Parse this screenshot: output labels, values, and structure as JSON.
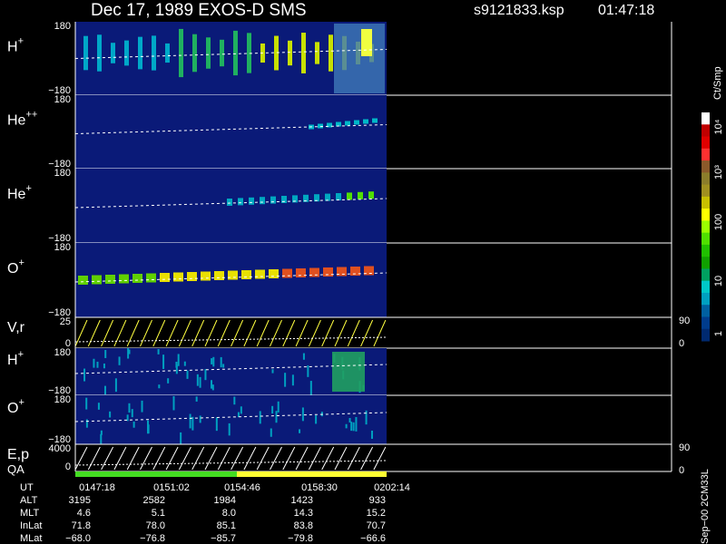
{
  "header": {
    "title": "Dec 17, 1989    EXOS-D SMS",
    "file": "s9121833.ksp",
    "time": "01:47:18"
  },
  "colorbar": {
    "unit": "Ct/Smp",
    "ticks": [
      "10⁴",
      "10³",
      "100",
      "10",
      "1"
    ],
    "colors": [
      "#ffffff",
      "#c00000",
      "#e00000",
      "#ff3030",
      "#8b5a2b",
      "#8b7d2b",
      "#a09020",
      "#c8c000",
      "#ffff00",
      "#9aff00",
      "#50e000",
      "#20c000",
      "#10a000",
      "#00a060",
      "#00c8c8",
      "#00a0c0",
      "#0060a0",
      "#003c8c",
      "#002a70"
    ]
  },
  "chart_data": {
    "type": "heatmap",
    "panels": [
      {
        "id": "h",
        "label": "H",
        "sup": "+",
        "ytop": "180",
        "ybot": "−180"
      },
      {
        "id": "he2",
        "label": "He",
        "sup": "++",
        "ytop": "180",
        "ybot": "−180"
      },
      {
        "id": "he1",
        "label": "He",
        "sup": "+",
        "ytop": "180",
        "ybot": "−180"
      },
      {
        "id": "o",
        "label": "O",
        "sup": "+",
        "ytop": "180",
        "ybot": "−180"
      },
      {
        "id": "vr",
        "label": "V,r",
        "sup": "",
        "ytop": "25",
        "ybot": "0",
        "rtop": "90",
        "rbot": "0"
      },
      {
        "id": "h2",
        "label": "H",
        "sup": "+",
        "ytop": "180",
        "ybot": "−180"
      },
      {
        "id": "o2",
        "label": "O",
        "sup": "+",
        "ytop": "180",
        "ybot": "−180"
      },
      {
        "id": "ep",
        "label": "E,p",
        "sup": "",
        "ytop": "4000",
        "ybot": "0",
        "rtop": "90",
        "rbot": "0"
      }
    ],
    "qa_label": "QA",
    "time_axis": {
      "row_labels": [
        "UT",
        "ALT",
        "MLT",
        "InLat",
        "MLat"
      ],
      "columns": [
        [
          "0147:18",
          "3195",
          "4.6",
          "71.8",
          "−68.0"
        ],
        [
          "0151:02",
          "2582",
          "5.1",
          "78.0",
          "−76.8"
        ],
        [
          "0154:46",
          "1984",
          "8.0",
          "85.1",
          "−85.7"
        ],
        [
          "0158:30",
          "1423",
          "14.3",
          "83.8",
          "−79.8"
        ],
        [
          "0202:14",
          "933",
          "15.2",
          "70.7",
          "−66.6"
        ]
      ]
    },
    "side_note": "Sep−00 2CM33L"
  }
}
